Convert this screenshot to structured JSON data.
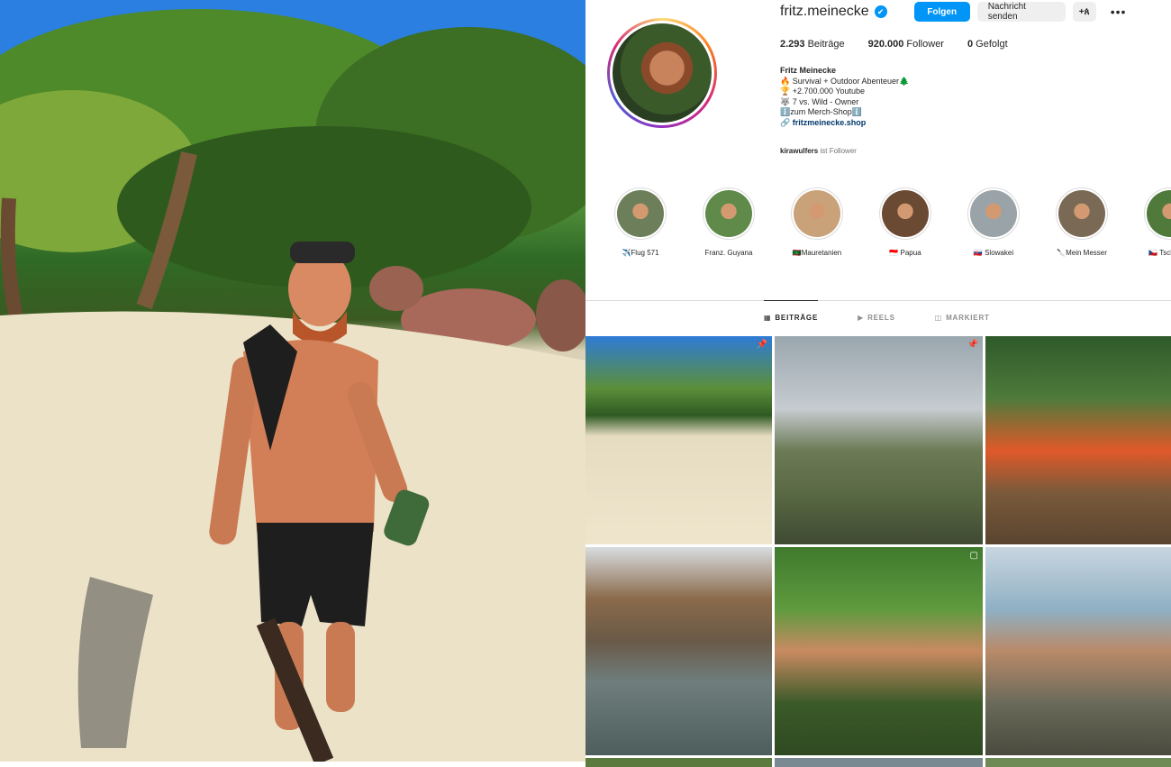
{
  "profile": {
    "username": "fritz.meinecke",
    "verified_mark": "✔",
    "follow_label": "Folgen",
    "message_label": "Nachricht senden",
    "suggest_label": "+ጰ",
    "more_label": "•••",
    "stats": {
      "posts_count": "2.293",
      "posts_label": "Beiträge",
      "followers_count": "920.000",
      "followers_label": "Follower",
      "following_count": "0",
      "following_label": "Gefolgt"
    },
    "bio": {
      "name": "Fritz Meinecke",
      "line1": "🔥 Survival + Outdoor Abenteuer🌲",
      "line2": "🏆 +2.700.000 Youtube",
      "line3": "🐺 7 vs. Wild - Owner",
      "line4": "ℹ️zum Merch-Shopℹ️",
      "link": "🔗 fritzmeinecke.shop"
    },
    "followed_by_user": "kirawulfers",
    "followed_by_suffix": " ist Follower"
  },
  "highlights": [
    {
      "label": "✈️Flug 571",
      "color": "#6d7f5a"
    },
    {
      "label": "Franz. Guyana",
      "color": "#5f8a4a"
    },
    {
      "label": "🇲🇷Mauretanien",
      "color": "#c9a27a"
    },
    {
      "label": "🇮🇩 Papua",
      "color": "#6b4a34"
    },
    {
      "label": "🇸🇰 Slowakei",
      "color": "#9aa3a8"
    },
    {
      "label": "🔪Mein Messer",
      "color": "#7a6a55"
    },
    {
      "label": "🇨🇿 Tschechie",
      "color": "#4f7a3c"
    }
  ],
  "tabs": [
    {
      "icon": "▦",
      "label": "BEITRÄGE",
      "active": true
    },
    {
      "icon": "▶",
      "label": "REELS",
      "active": false
    },
    {
      "icon": "◫",
      "label": "MARKIERT",
      "active": false
    }
  ],
  "posts": [
    {
      "name": "post-beach-selfie",
      "icon": "📌",
      "bg": "linear-gradient(180deg,#2e7bd6 0%,#5b8f3a 25%,#2f5a22 38%,#e6dcc2 48%,#efe5cc 100%)"
    },
    {
      "name": "post-fish-knife",
      "icon": "📌",
      "bg": "linear-gradient(180deg,#9aa6ae 0%,#c6ccd0 35%,#6c7a55 55%,#5a6a44 75%,#3f4a32 100%)"
    },
    {
      "name": "post-campfire",
      "icon": "",
      "bg": "linear-gradient(180deg,#2e5a2a 0%,#4f7a3c 30%,#e0592a 55%,#7a5a3a 75%,#5a4430 100%)"
    },
    {
      "name": "post-river-log",
      "icon": "",
      "bg": "linear-gradient(180deg,#d8dde0 0%,#8a6a4a 25%,#6a5a48 45%,#6f7e7c 65%,#4e5e5c 100%)"
    },
    {
      "name": "post-jungle-selfie",
      "icon": "▢",
      "bg": "linear-gradient(180deg,#3f7a2e 0%,#5f9a3e 30%,#c98a62 50%,#3a5a28 75%,#2f4a22 100%)"
    },
    {
      "name": "post-fish-catch",
      "icon": "",
      "bg": "linear-gradient(180deg,#c9d6e0 0%,#8fb0c4 30%,#b98a68 50%,#6a6a5a 75%,#4a4a3e 100%)"
    },
    {
      "name": "post-row3-a",
      "icon": "",
      "bg": "#5b7a3e"
    },
    {
      "name": "post-row3-b",
      "icon": "",
      "bg": "#7a8a92"
    },
    {
      "name": "post-row3-c",
      "icon": "",
      "bg": "#6e8a55"
    }
  ]
}
